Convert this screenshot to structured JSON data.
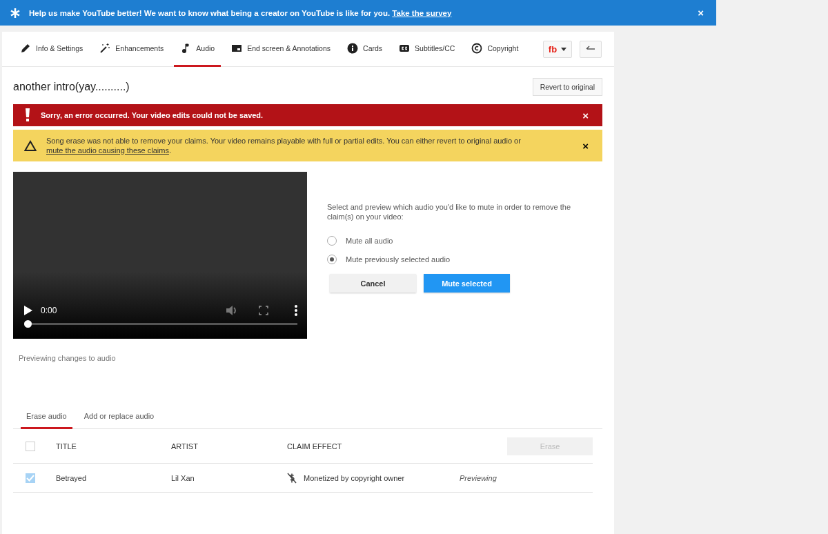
{
  "banner": {
    "text": "Help us make YouTube better! We want to know what being a creator on YouTube is like for you.",
    "link": "Take the survey",
    "close": "×"
  },
  "tabs": [
    {
      "label": "Info & Settings",
      "kind": "pencil",
      "selected": false
    },
    {
      "label": "Enhancements",
      "kind": "wand",
      "selected": false
    },
    {
      "label": "Audio",
      "kind": "note",
      "selected": true
    },
    {
      "label": "End screen & Annotations",
      "kind": "screen",
      "selected": false
    },
    {
      "label": "Cards",
      "kind": "info",
      "selected": false
    },
    {
      "label": "Subtitles/CC",
      "kind": "cc",
      "selected": false
    },
    {
      "label": "Copyright",
      "kind": "copyright",
      "selected": false
    }
  ],
  "account_menu": {
    "label": "fb"
  },
  "video_title": "another intro(yay..........)",
  "revert_button": "Revert to original",
  "alerts": [
    {
      "kind": "error",
      "text": "Sorry, an error occurred. Your video edits could not be saved.",
      "close": "×"
    },
    {
      "kind": "warning",
      "text": "Song erase was not able to remove your claims. Your video remains playable with full or partial edits. You can either revert to original audio or",
      "link": "mute the audio causing these claims",
      "end": ".",
      "close": "×"
    }
  ],
  "player": {
    "time": "0:00",
    "level": 0
  },
  "preview_note": "Previewing changes to audio",
  "mute_panel": {
    "prompt": "Select and preview which audio you'd like to mute in order to remove the claim(s) on your video:",
    "options": [
      {
        "label": "Mute all audio",
        "selected": false
      },
      {
        "label": "Mute previously selected audio",
        "selected": true
      }
    ],
    "cancel": "Cancel",
    "confirm": "Mute selected"
  },
  "sub_tabs": [
    {
      "label": "Erase audio",
      "selected": true
    },
    {
      "label": "Add or replace audio",
      "selected": false
    }
  ],
  "table": {
    "select_all": {
      "checked": false
    },
    "columns": [
      "TITLE",
      "ARTIST",
      "CLAIM EFFECT"
    ],
    "erase_button": {
      "label": "Erase",
      "disabled": true
    },
    "rows": [
      {
        "checked": true,
        "title": "Betrayed",
        "artist": "Lil Xan",
        "effect": "Monetized by copyright owner",
        "status": "Previewing"
      }
    ]
  }
}
